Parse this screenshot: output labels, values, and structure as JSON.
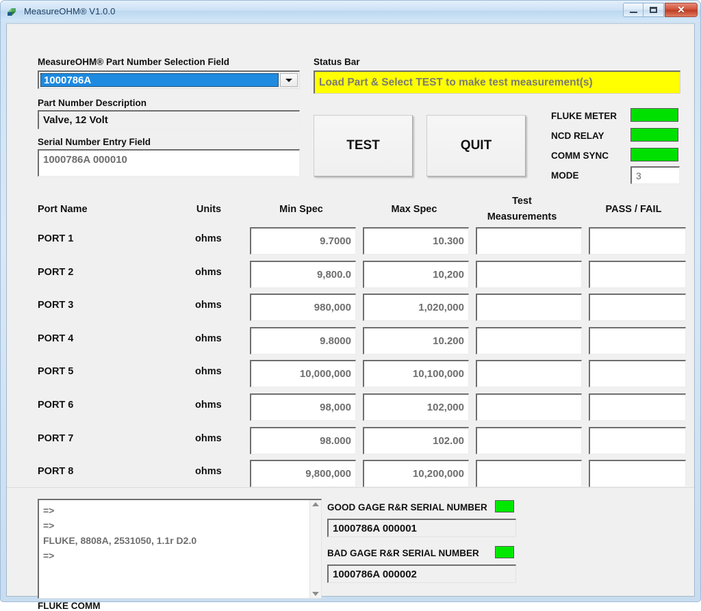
{
  "window": {
    "title": "MeasureOHM® V1.0.0",
    "icon": "app-icon",
    "buttons": {
      "minimize": "minimize-icon",
      "maximize": "maximize-icon",
      "close": "✕"
    }
  },
  "colors": {
    "accent_blue": "#1e8ae0",
    "status_yellow": "#ffff00",
    "status_text": "#7b7b74",
    "led_green": "#00e000",
    "client_bg": "#f0f0f0",
    "value_text": "#6e6e6e"
  },
  "part_selection": {
    "label": "MeasureOHM® Part Number Selection Field",
    "value": "1000786A",
    "arrow": "chevron-down-icon"
  },
  "part_description": {
    "label": "Part Number Description",
    "value": "Valve, 12 Volt"
  },
  "serial_entry": {
    "label": "Serial Number Entry Field",
    "value": "1000786A 000010"
  },
  "status": {
    "label": "Status Bar",
    "message": "Load Part & Select TEST to make test measurement(s)"
  },
  "actions": {
    "test": "TEST",
    "quit": "QUIT"
  },
  "indicators": [
    {
      "label": "FLUKE METER",
      "state": "on"
    },
    {
      "label": "NCD RELAY",
      "state": "on"
    },
    {
      "label": "COMM SYNC",
      "state": "on"
    }
  ],
  "mode": {
    "label": "MODE",
    "value": "3"
  },
  "table": {
    "headers": {
      "port_name": "Port Name",
      "units": "Units",
      "min_spec": "Min Spec",
      "max_spec": "Max Spec",
      "test_measurements_line1": "Test",
      "test_measurements_line2": "Measurements",
      "pass_fail": "PASS / FAIL"
    },
    "rows": [
      {
        "port": "PORT 1",
        "units": "ohms",
        "min": "9.7000",
        "max": "10.300",
        "measurement": "",
        "pass_fail": ""
      },
      {
        "port": "PORT 2",
        "units": "ohms",
        "min": "9,800.0",
        "max": "10,200",
        "measurement": "",
        "pass_fail": ""
      },
      {
        "port": "PORT 3",
        "units": "ohms",
        "min": "980,000",
        "max": "1,020,000",
        "measurement": "",
        "pass_fail": ""
      },
      {
        "port": "PORT 4",
        "units": "ohms",
        "min": "9.8000",
        "max": "10.200",
        "measurement": "",
        "pass_fail": ""
      },
      {
        "port": "PORT 5",
        "units": "ohms",
        "min": "10,000,000",
        "max": "10,100,000",
        "measurement": "",
        "pass_fail": ""
      },
      {
        "port": "PORT 6",
        "units": "ohms",
        "min": "98,000",
        "max": "102,000",
        "measurement": "",
        "pass_fail": ""
      },
      {
        "port": "PORT 7",
        "units": "ohms",
        "min": "98.000",
        "max": "102.00",
        "measurement": "",
        "pass_fail": ""
      },
      {
        "port": "PORT 8",
        "units": "ohms",
        "min": "9,800,000",
        "max": "10,200,000",
        "measurement": "",
        "pass_fail": ""
      }
    ]
  },
  "console": {
    "text": "=>\n=>\nFLUKE, 8808A, 2531050, 1.1r D2.0\n=>",
    "caption": "FLUKE COMM",
    "scroll_up": "scroll-up-icon",
    "scroll_down": "scroll-down-icon"
  },
  "gage": {
    "good": {
      "label": "GOOD GAGE R&R SERIAL NUMBER",
      "value": "1000786A 000001",
      "state": "on"
    },
    "bad": {
      "label": "BAD GAGE R&R SERIAL NUMBER",
      "value": "1000786A 000002",
      "state": "on"
    }
  }
}
